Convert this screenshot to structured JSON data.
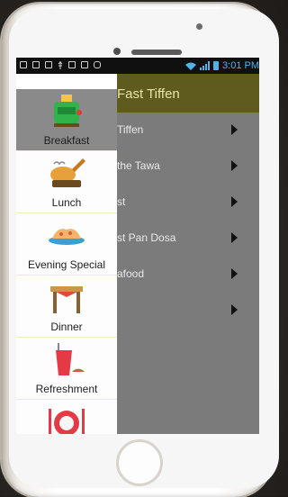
{
  "status_bar": {
    "time": "3:01 PM",
    "icons": [
      "gallery-icon",
      "message-icon",
      "mail-icon",
      "usb-icon",
      "briefcase-icon",
      "photo-icon",
      "gamepad-icon"
    ]
  },
  "app_bar": {
    "title": "Fast Tiffen"
  },
  "list": {
    "items": [
      {
        "label": "Tiffen"
      },
      {
        "label": "the Tawa"
      },
      {
        "label": "st"
      },
      {
        "label": "st Pan Dosa"
      },
      {
        "label": "afood"
      },
      {
        "label": ""
      }
    ]
  },
  "drawer": {
    "categories": [
      {
        "label": "Breakfast",
        "icon": "toaster-icon",
        "selected": true
      },
      {
        "label": "Lunch",
        "icon": "roast-chicken-icon",
        "selected": false
      },
      {
        "label": "Evening Special",
        "icon": "snack-plate-icon",
        "selected": false
      },
      {
        "label": "Dinner",
        "icon": "dining-table-icon",
        "selected": false
      },
      {
        "label": "Refreshment",
        "icon": "juice-icon",
        "selected": false
      },
      {
        "label": "",
        "icon": "plate-cutlery-icon",
        "selected": false
      }
    ]
  },
  "colors": {
    "app_bar_bg": "#5f5a1e",
    "app_bar_text": "#e8e4a8",
    "status_accent": "#4fb3e8",
    "selected_category_bg": "#8a8a8a"
  }
}
